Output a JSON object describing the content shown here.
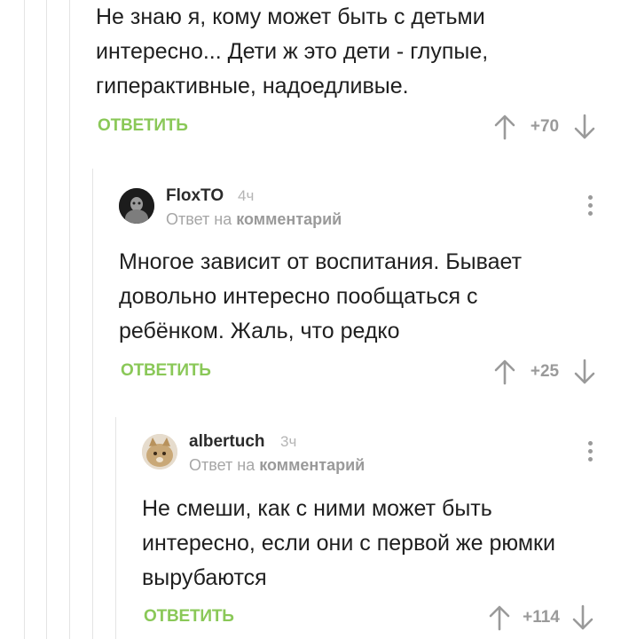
{
  "comments": [
    {
      "text_lines": [
        "Не знаю я, кому может быть с детьми",
        "интересно... Дети ж это дети - глупые,",
        "гиперактивные, надоедливые."
      ],
      "reply_label": "ОТВЕТИТЬ",
      "rating": "+70"
    },
    {
      "author": "FloxTO",
      "time": "4ч",
      "reply_prefix": "Ответ на",
      "reply_target": "комментарий",
      "text_lines": [
        "Многое зависит от воспитания. Бывает",
        "довольно интересно пообщаться с",
        "ребёнком. Жаль, что редко"
      ],
      "reply_label": "ОТВЕТИТЬ",
      "rating": "+25"
    },
    {
      "author": "albertuch",
      "time": "3ч",
      "reply_prefix": "Ответ на",
      "reply_target": "комментарий",
      "text_lines": [
        "Не смеши, как с ними может быть",
        "интересно, если они с первой же рюмки",
        "вырубаются"
      ],
      "reply_label": "ОТВЕТИТЬ",
      "rating": "+114"
    }
  ],
  "icons": {
    "upvote": "arrow-up-icon",
    "downvote": "arrow-down-icon",
    "more": "more-vertical-icon"
  },
  "colors": {
    "reply": "#8ac858",
    "rating": "#9a9a9a",
    "thread_line": "#e4e4e4"
  }
}
